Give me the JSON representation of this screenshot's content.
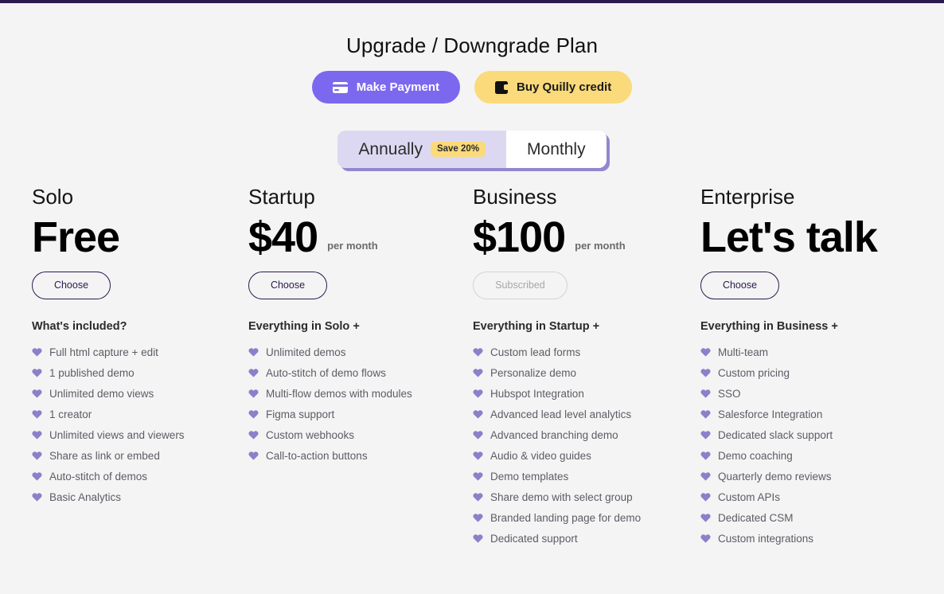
{
  "header": {
    "title": "Upgrade / Downgrade Plan",
    "actions": [
      {
        "label": "Make Payment",
        "icon": "credit-card-icon",
        "color": "#7b68ee",
        "text_color": "#ffffff"
      },
      {
        "label": "Buy Quilly credit",
        "icon": "wallet-icon",
        "color": "#fada7a",
        "text_color": "#1a1a1a"
      }
    ]
  },
  "billing_toggle": {
    "options": [
      {
        "label": "Annually",
        "badge": "Save 20%",
        "selected": true
      },
      {
        "label": "Monthly",
        "badge": "",
        "selected": false
      }
    ],
    "selected_color": "#ddd8f2",
    "badge_color": "#fada7a",
    "shadow_color": "#9287cf"
  },
  "theme": {
    "background": "#f4f4f4",
    "top_bar": "#2b1a4d",
    "accent_purple": "#7b68ee",
    "accent_yellow": "#fada7a",
    "heart_color": "#8b80c9"
  },
  "plans": [
    {
      "name": "Solo",
      "price": "Free",
      "period": "",
      "cta": "Choose",
      "cta_disabled": false,
      "included_title": "What's included?",
      "features": [
        "Full html capture + edit",
        "1 published demo",
        "Unlimited demo views",
        "1 creator",
        "Unlimited views and viewers",
        "Share as link or embed",
        "Auto-stitch of demos",
        "Basic Analytics"
      ]
    },
    {
      "name": "Startup",
      "price": "$40",
      "period": "per month",
      "cta": "Choose",
      "cta_disabled": false,
      "included_title": "Everything in Solo +",
      "features": [
        "Unlimited demos",
        "Auto-stitch of demo flows",
        "Multi-flow demos with modules",
        "Figma support",
        "Custom webhooks",
        "Call-to-action buttons"
      ]
    },
    {
      "name": "Business",
      "price": "$100",
      "period": "per month",
      "cta": "Subscribed",
      "cta_disabled": true,
      "included_title": "Everything in Startup +",
      "features": [
        "Custom lead forms",
        "Personalize demo",
        "Hubspot Integration",
        "Advanced lead level analytics",
        "Advanced branching demo",
        "Audio & video guides",
        "Demo templates",
        "Share demo with select group",
        "Branded landing page for demo",
        "Dedicated support"
      ]
    },
    {
      "name": "Enterprise",
      "price": "Let's talk",
      "period": "",
      "cta": "Choose",
      "cta_disabled": false,
      "included_title": "Everything in Business +",
      "features": [
        "Multi-team",
        "Custom pricing",
        "SSO",
        "Salesforce Integration",
        "Dedicated slack support",
        "Demo coaching",
        "Quarterly demo reviews",
        "Custom APIs",
        "Dedicated CSM",
        "Custom integrations"
      ]
    }
  ]
}
